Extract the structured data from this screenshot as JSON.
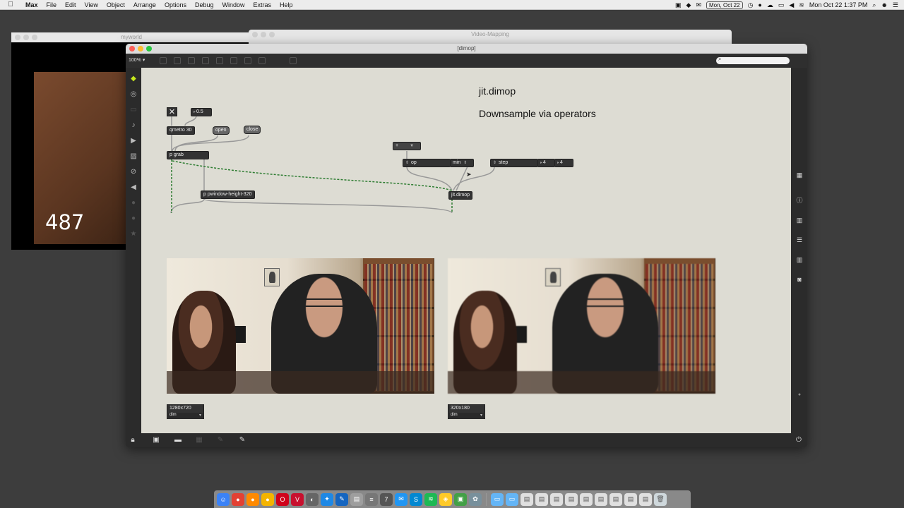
{
  "menubar": {
    "app_name": "Max",
    "items": [
      "File",
      "Edit",
      "View",
      "Object",
      "Arrange",
      "Options",
      "Debug",
      "Window",
      "Extras",
      "Help"
    ],
    "date_badge": "Mon, Oct 22",
    "clock": "Mon Oct 22  1:37 PM"
  },
  "windows": {
    "myworld_title": "myworld",
    "myworld_counter": "487",
    "video_mapping_title": "Video-Mapping",
    "main_title": "[dimop]"
  },
  "toolbar": {
    "zoom": "100%"
  },
  "patch": {
    "title": "jit.dimop",
    "subtitle": "Downsample via operators",
    "toggle_symbol": "✕",
    "numbox_value": "0.5",
    "qmetro": "qmetro 30",
    "open": "open",
    "close": "close",
    "p_grab": "p grab",
    "p_pwindow": "p pwindow-height-320",
    "operator_menu": "+",
    "op_label": "op",
    "op_value": "min",
    "step_label": "step",
    "step_x": "4",
    "step_y": "4",
    "jit_dimop": "jit.dimop",
    "dim_left_value": "1280x720",
    "dim_left_label": "dim",
    "dim_right_value": "320x180",
    "dim_right_label": "dim"
  },
  "colors": {
    "canvas": "#dddcd3",
    "patch_cord_signal": "#2e7d32",
    "patch_cord": "#999999"
  }
}
